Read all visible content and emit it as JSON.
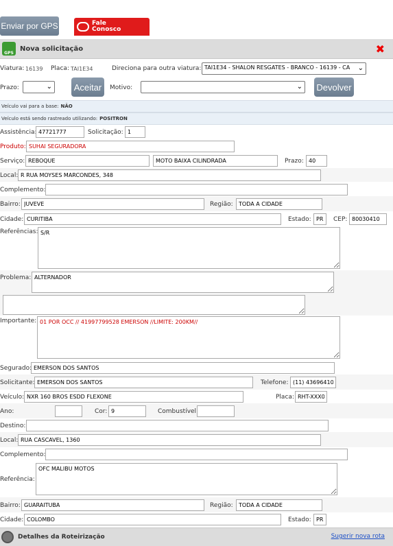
{
  "top": {
    "gps_button": "Enviar por GPS",
    "fale_line1": "Fale",
    "fale_line2": "Conosco"
  },
  "header": {
    "title": "Nova solicitação",
    "icon_text": "GPS"
  },
  "viatura": {
    "viatura_label": "Viatura:",
    "viatura_value": "16139",
    "placa_label": "Placa:",
    "placa_value": "TAI1E34",
    "direciona_label": "Direciona para outra viatura:",
    "direciona_value": "TAI1E34 - SHALON RESGATES - BRANCO - 16139 - CA"
  },
  "actions": {
    "prazo_label": "Prazo:",
    "prazo_value": "",
    "aceitar_label": "Aceitar",
    "motivo_label": "Motivo:",
    "motivo_value": "",
    "devolver_label": "Devolver"
  },
  "info": {
    "base_text": "Veículo vai para a base:",
    "base_value": "NÃO",
    "rastreado_text": "Veículo está sendo rastreado utilizando:",
    "rastreado_value": "POSITRON"
  },
  "form": {
    "assistencia_label": "Assistência:",
    "assistencia_value": "47721777",
    "solicitacao_label": "Solicitação:",
    "solicitacao_value": "1",
    "produto_label": "Produto:",
    "produto_value": "SUHAI SEGURADORA",
    "servico_label": "Serviço:",
    "servico_value": "REBOQUE",
    "servico_value2": "MOTO BAIXA CILINDRADA",
    "prazo_label": "Prazo:",
    "prazo_value": "40",
    "local_label": "Local:",
    "local_value": "R RUA MOYSES MARCONDES, 348",
    "complemento_label": "Complemento:",
    "complemento_value": "",
    "bairro_label": "Bairro:",
    "bairro_value": "JUVEVE",
    "regiao_label": "Região:",
    "regiao_value": "TODA A CIDADE",
    "cidade_label": "Cidade:",
    "cidade_value": "CURITIBA",
    "estado_label": "Estado:",
    "estado_value": "PR",
    "cep_label": "CEP:",
    "cep_value": "80030410",
    "referencias_label": "Referências:",
    "referencias_value": "S/R",
    "problema_label": "Problema:",
    "problema_value": "ALTERNADOR",
    "extra_value": "",
    "importante_label": "Importante:",
    "importante_value": "01 POR OCC // 41997799528 EMERSON //LIMITE: 200KM//",
    "segurado_label": "Segurado:",
    "segurado_value": "EMERSON DOS SANTOS",
    "solicitante_label": "Solicitante:",
    "solicitante_value": "EMERSON DOS SANTOS",
    "telefone_label": "Telefone:",
    "telefone_value": "(11) 43696410",
    "veiculo_label": "Veículo:",
    "veiculo_value": "NXR 160 BROS ESDD FLEXONE",
    "placa_label": "Placa:",
    "placa_value": "RHT-XXX0",
    "ano_label": "Ano:",
    "ano_value": "",
    "cor_label": "Cor:",
    "cor_value": "9",
    "combustivel_label": "Combustível:",
    "combustivel_value": ""
  },
  "destino": {
    "destino_label": "Destino:",
    "destino_value": "",
    "local_label": "Local:",
    "local_value": "RUA CASCAVEL, 1360",
    "complemento_label": "Complemento:",
    "complemento_value": "",
    "referencia_label": "Referência:",
    "referencia_value": "OFC MALIBU MOTOS",
    "bairro_label": "Bairro:",
    "bairro_value": "GUARAITUBA",
    "regiao_label": "Região:",
    "regiao_value": "TODA A CIDADE",
    "cidade_label": "Cidade:",
    "cidade_value": "COLOMBO",
    "estado_label": "Estado:",
    "estado_value": "PR"
  },
  "footer": {
    "title": "Detalhes da Roteirização",
    "link": "Sugerir nova rota"
  },
  "colors": {
    "accent_red": "#e01b1b",
    "button_blue": "#7a8b9d",
    "close_red": "#ee0000",
    "link_blue": "#1b4fc7"
  }
}
